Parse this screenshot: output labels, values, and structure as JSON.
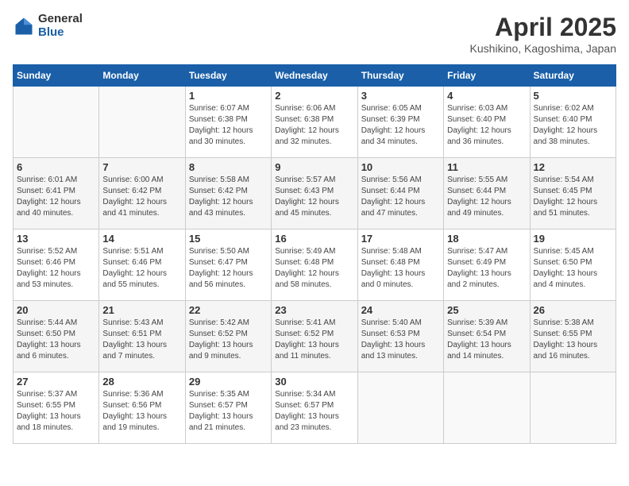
{
  "logo": {
    "general": "General",
    "blue": "Blue"
  },
  "title": {
    "month": "April 2025",
    "location": "Kushikino, Kagoshima, Japan"
  },
  "weekdays": [
    "Sunday",
    "Monday",
    "Tuesday",
    "Wednesday",
    "Thursday",
    "Friday",
    "Saturday"
  ],
  "weeks": [
    [
      {
        "day": "",
        "info": ""
      },
      {
        "day": "",
        "info": ""
      },
      {
        "day": "1",
        "info": "Sunrise: 6:07 AM\nSunset: 6:38 PM\nDaylight: 12 hours\nand 30 minutes."
      },
      {
        "day": "2",
        "info": "Sunrise: 6:06 AM\nSunset: 6:38 PM\nDaylight: 12 hours\nand 32 minutes."
      },
      {
        "day": "3",
        "info": "Sunrise: 6:05 AM\nSunset: 6:39 PM\nDaylight: 12 hours\nand 34 minutes."
      },
      {
        "day": "4",
        "info": "Sunrise: 6:03 AM\nSunset: 6:40 PM\nDaylight: 12 hours\nand 36 minutes."
      },
      {
        "day": "5",
        "info": "Sunrise: 6:02 AM\nSunset: 6:40 PM\nDaylight: 12 hours\nand 38 minutes."
      }
    ],
    [
      {
        "day": "6",
        "info": "Sunrise: 6:01 AM\nSunset: 6:41 PM\nDaylight: 12 hours\nand 40 minutes."
      },
      {
        "day": "7",
        "info": "Sunrise: 6:00 AM\nSunset: 6:42 PM\nDaylight: 12 hours\nand 41 minutes."
      },
      {
        "day": "8",
        "info": "Sunrise: 5:58 AM\nSunset: 6:42 PM\nDaylight: 12 hours\nand 43 minutes."
      },
      {
        "day": "9",
        "info": "Sunrise: 5:57 AM\nSunset: 6:43 PM\nDaylight: 12 hours\nand 45 minutes."
      },
      {
        "day": "10",
        "info": "Sunrise: 5:56 AM\nSunset: 6:44 PM\nDaylight: 12 hours\nand 47 minutes."
      },
      {
        "day": "11",
        "info": "Sunrise: 5:55 AM\nSunset: 6:44 PM\nDaylight: 12 hours\nand 49 minutes."
      },
      {
        "day": "12",
        "info": "Sunrise: 5:54 AM\nSunset: 6:45 PM\nDaylight: 12 hours\nand 51 minutes."
      }
    ],
    [
      {
        "day": "13",
        "info": "Sunrise: 5:52 AM\nSunset: 6:46 PM\nDaylight: 12 hours\nand 53 minutes."
      },
      {
        "day": "14",
        "info": "Sunrise: 5:51 AM\nSunset: 6:46 PM\nDaylight: 12 hours\nand 55 minutes."
      },
      {
        "day": "15",
        "info": "Sunrise: 5:50 AM\nSunset: 6:47 PM\nDaylight: 12 hours\nand 56 minutes."
      },
      {
        "day": "16",
        "info": "Sunrise: 5:49 AM\nSunset: 6:48 PM\nDaylight: 12 hours\nand 58 minutes."
      },
      {
        "day": "17",
        "info": "Sunrise: 5:48 AM\nSunset: 6:48 PM\nDaylight: 13 hours\nand 0 minutes."
      },
      {
        "day": "18",
        "info": "Sunrise: 5:47 AM\nSunset: 6:49 PM\nDaylight: 13 hours\nand 2 minutes."
      },
      {
        "day": "19",
        "info": "Sunrise: 5:45 AM\nSunset: 6:50 PM\nDaylight: 13 hours\nand 4 minutes."
      }
    ],
    [
      {
        "day": "20",
        "info": "Sunrise: 5:44 AM\nSunset: 6:50 PM\nDaylight: 13 hours\nand 6 minutes."
      },
      {
        "day": "21",
        "info": "Sunrise: 5:43 AM\nSunset: 6:51 PM\nDaylight: 13 hours\nand 7 minutes."
      },
      {
        "day": "22",
        "info": "Sunrise: 5:42 AM\nSunset: 6:52 PM\nDaylight: 13 hours\nand 9 minutes."
      },
      {
        "day": "23",
        "info": "Sunrise: 5:41 AM\nSunset: 6:52 PM\nDaylight: 13 hours\nand 11 minutes."
      },
      {
        "day": "24",
        "info": "Sunrise: 5:40 AM\nSunset: 6:53 PM\nDaylight: 13 hours\nand 13 minutes."
      },
      {
        "day": "25",
        "info": "Sunrise: 5:39 AM\nSunset: 6:54 PM\nDaylight: 13 hours\nand 14 minutes."
      },
      {
        "day": "26",
        "info": "Sunrise: 5:38 AM\nSunset: 6:55 PM\nDaylight: 13 hours\nand 16 minutes."
      }
    ],
    [
      {
        "day": "27",
        "info": "Sunrise: 5:37 AM\nSunset: 6:55 PM\nDaylight: 13 hours\nand 18 minutes."
      },
      {
        "day": "28",
        "info": "Sunrise: 5:36 AM\nSunset: 6:56 PM\nDaylight: 13 hours\nand 19 minutes."
      },
      {
        "day": "29",
        "info": "Sunrise: 5:35 AM\nSunset: 6:57 PM\nDaylight: 13 hours\nand 21 minutes."
      },
      {
        "day": "30",
        "info": "Sunrise: 5:34 AM\nSunset: 6:57 PM\nDaylight: 13 hours\nand 23 minutes."
      },
      {
        "day": "",
        "info": ""
      },
      {
        "day": "",
        "info": ""
      },
      {
        "day": "",
        "info": ""
      }
    ]
  ]
}
